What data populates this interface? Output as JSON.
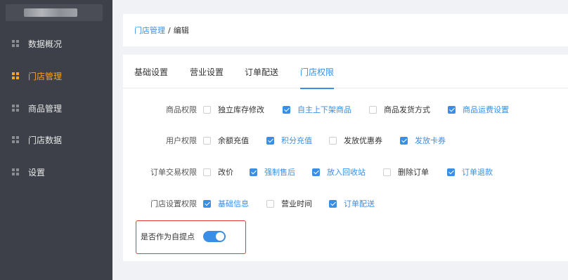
{
  "sidebar": {
    "items": [
      {
        "label": "数据概况",
        "active": false
      },
      {
        "label": "门店管理",
        "active": true
      },
      {
        "label": "商品管理",
        "active": false
      },
      {
        "label": "门店数据",
        "active": false
      },
      {
        "label": "设置",
        "active": false
      }
    ]
  },
  "breadcrumb": {
    "parent": "门店管理",
    "separator": "/",
    "current": "编辑"
  },
  "tabs": [
    {
      "label": "基础设置",
      "active": false
    },
    {
      "label": "营业设置",
      "active": false
    },
    {
      "label": "订单配送",
      "active": false
    },
    {
      "label": "门店权限",
      "active": true
    }
  ],
  "permissions": [
    {
      "label": "商品权限",
      "options": [
        {
          "label": "独立库存修改",
          "checked": false
        },
        {
          "label": "自主上下架商品",
          "checked": true
        },
        {
          "label": "商品发货方式",
          "checked": false
        },
        {
          "label": "商品运费设置",
          "checked": true
        }
      ]
    },
    {
      "label": "用户权限",
      "options": [
        {
          "label": "余额充值",
          "checked": false
        },
        {
          "label": "积分充值",
          "checked": true
        },
        {
          "label": "发放优惠券",
          "checked": false
        },
        {
          "label": "发放卡券",
          "checked": true
        }
      ]
    },
    {
      "label": "订单交易权限",
      "options": [
        {
          "label": "改价",
          "checked": false
        },
        {
          "label": "强制售后",
          "checked": true
        },
        {
          "label": "放入回收站",
          "checked": true
        },
        {
          "label": "删除订单",
          "checked": false
        },
        {
          "label": "订单退款",
          "checked": true
        }
      ]
    },
    {
      "label": "门店设置权限",
      "options": [
        {
          "label": "基础信息",
          "checked": true
        },
        {
          "label": "营业时间",
          "checked": false
        },
        {
          "label": "订单配送",
          "checked": true
        }
      ]
    }
  ],
  "pickup": {
    "label": "是否作为自提点",
    "enabled": true
  },
  "colors": {
    "accent": "#3a8ee6",
    "sidebar_bg": "#3d4049",
    "active_menu": "#f5a623",
    "highlight_border": "#e53935"
  }
}
